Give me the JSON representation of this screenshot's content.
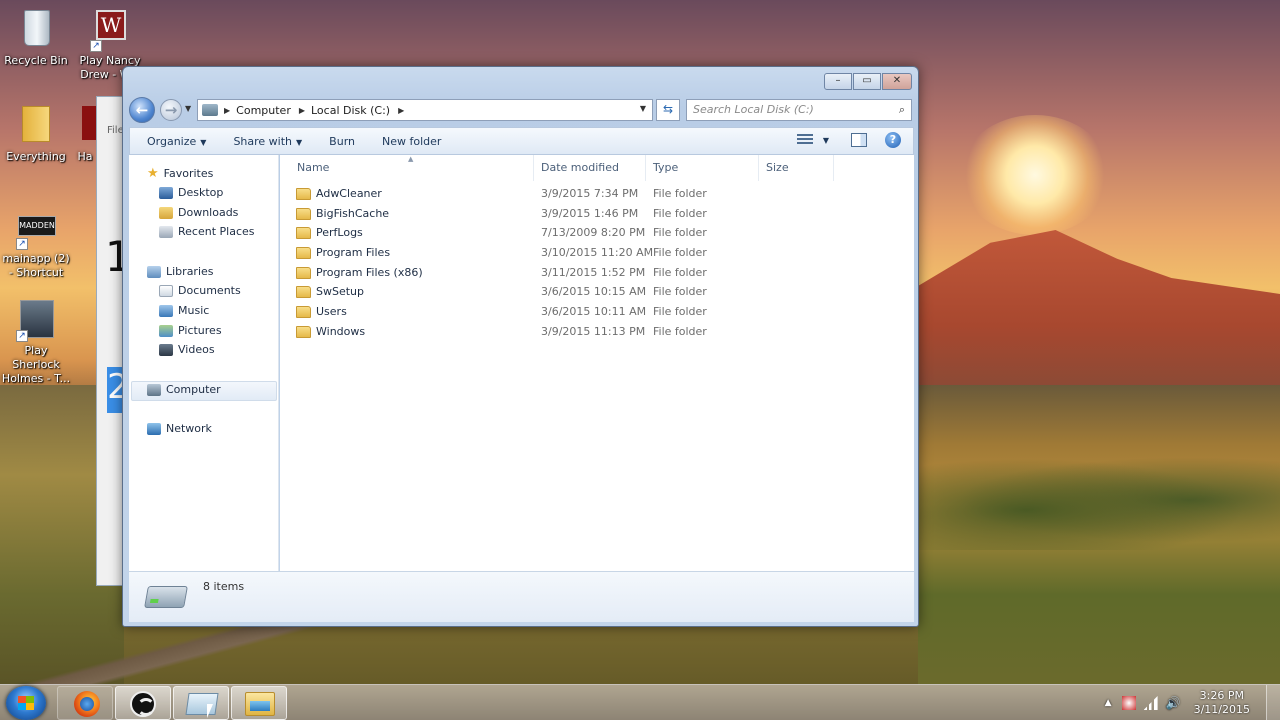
{
  "desktop": {
    "icons": [
      {
        "label": "Recycle Bin"
      },
      {
        "label": "Play Nancy Drew - W..."
      },
      {
        "label": "Everything"
      },
      {
        "label": "Ha"
      },
      {
        "label": "mainapp (2) - Shortcut"
      },
      {
        "label": "Play Sherlock Holmes - T..."
      }
    ],
    "bg_window": {
      "menu_fragment": "File",
      "big_text_1": "1",
      "big_text_2": "2"
    }
  },
  "window": {
    "address": {
      "crumbs": [
        "Computer",
        "Local Disk (C:)"
      ]
    },
    "search": {
      "placeholder": "Search Local Disk (C:)"
    },
    "toolbar": {
      "organize": "Organize",
      "share_with": "Share with",
      "burn": "Burn",
      "new_folder": "New folder"
    },
    "nav": {
      "favorites": "Favorites",
      "desktop": "Desktop",
      "downloads": "Downloads",
      "recent_places": "Recent Places",
      "libraries": "Libraries",
      "documents": "Documents",
      "music": "Music",
      "pictures": "Pictures",
      "videos": "Videos",
      "computer": "Computer",
      "network": "Network"
    },
    "columns": {
      "name": "Name",
      "date_modified": "Date modified",
      "type": "Type",
      "size": "Size"
    },
    "files": [
      {
        "name": "AdwCleaner",
        "date": "3/9/2015 7:34 PM",
        "type": "File folder"
      },
      {
        "name": "BigFishCache",
        "date": "3/9/2015 1:46 PM",
        "type": "File folder"
      },
      {
        "name": "PerfLogs",
        "date": "7/13/2009 8:20 PM",
        "type": "File folder"
      },
      {
        "name": "Program Files",
        "date": "3/10/2015 11:20 AM",
        "type": "File folder"
      },
      {
        "name": "Program Files (x86)",
        "date": "3/11/2015 1:52 PM",
        "type": "File folder"
      },
      {
        "name": "SwSetup",
        "date": "3/6/2015 10:15 AM",
        "type": "File folder"
      },
      {
        "name": "Users",
        "date": "3/6/2015 10:11 AM",
        "type": "File folder"
      },
      {
        "name": "Windows",
        "date": "3/9/2015 11:13 PM",
        "type": "File folder"
      }
    ],
    "details": {
      "count": "8 items"
    }
  },
  "taskbar": {
    "time": "3:26 PM",
    "date": "3/11/2015"
  }
}
